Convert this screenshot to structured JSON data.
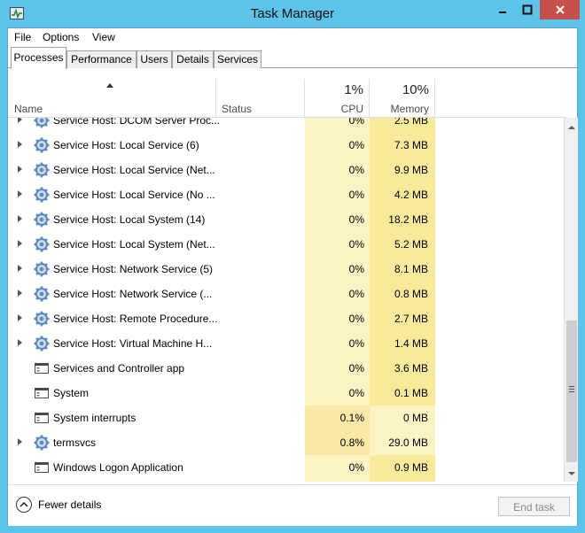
{
  "window": {
    "title": "Task Manager"
  },
  "menu": {
    "items": [
      "File",
      "Options",
      "View"
    ]
  },
  "tabs": [
    "Processes",
    "Performance",
    "Users",
    "Details",
    "Services"
  ],
  "active_tab": "Processes",
  "columns": {
    "name": "Name",
    "status": "Status",
    "cpu": {
      "label": "CPU",
      "total": "1%"
    },
    "memory": {
      "label": "Memory",
      "total": "10%"
    }
  },
  "rows": [
    {
      "name": "Service Host: DCOM Server Proc...",
      "cpu": "0%",
      "mem": "2.5 MB",
      "icon": "gear-icon",
      "expandable": true
    },
    {
      "name": "Service Host: Local Service (6)",
      "cpu": "0%",
      "mem": "7.3 MB",
      "icon": "gear-icon",
      "expandable": true
    },
    {
      "name": "Service Host: Local Service (Net...",
      "cpu": "0%",
      "mem": "9.9 MB",
      "icon": "gear-icon",
      "expandable": true
    },
    {
      "name": "Service Host: Local Service (No ...",
      "cpu": "0%",
      "mem": "4.2 MB",
      "icon": "gear-icon",
      "expandable": true
    },
    {
      "name": "Service Host: Local System (14)",
      "cpu": "0%",
      "mem": "18.2 MB",
      "icon": "gear-icon",
      "expandable": true
    },
    {
      "name": "Service Host: Local System (Net...",
      "cpu": "0%",
      "mem": "5.2 MB",
      "icon": "gear-icon",
      "expandable": true
    },
    {
      "name": "Service Host: Network Service (5)",
      "cpu": "0%",
      "mem": "8.1 MB",
      "icon": "gear-icon",
      "expandable": true
    },
    {
      "name": "Service Host: Network Service (...",
      "cpu": "0%",
      "mem": "0.8 MB",
      "icon": "gear-icon",
      "expandable": true
    },
    {
      "name": "Service Host: Remote Procedure...",
      "cpu": "0%",
      "mem": "2.7 MB",
      "icon": "gear-icon",
      "expandable": true
    },
    {
      "name": "Service Host: Virtual Machine H...",
      "cpu": "0%",
      "mem": "1.4 MB",
      "icon": "gear-icon",
      "expandable": true
    },
    {
      "name": "Services and Controller app",
      "cpu": "0%",
      "mem": "3.6 MB",
      "icon": "window-icon",
      "expandable": false
    },
    {
      "name": "System",
      "cpu": "0%",
      "mem": "0.1 MB",
      "icon": "window-icon",
      "expandable": false
    },
    {
      "name": "System interrupts",
      "cpu": "0.1%",
      "mem": "0 MB",
      "icon": "window-icon",
      "expandable": false,
      "highlight": true
    },
    {
      "name": "termsvcs",
      "cpu": "0.8%",
      "mem": "29.0 MB",
      "icon": "gear-icon",
      "expandable": true,
      "highlight": true
    },
    {
      "name": "Windows Logon Application",
      "cpu": "0%",
      "mem": "0.9 MB",
      "icon": "window-icon",
      "expandable": false
    }
  ],
  "footer": {
    "fewer_details": "Fewer details",
    "end_task": "End task"
  },
  "colors": {
    "title_bar": "#5ec3e8",
    "close_button": "#c7504c",
    "cpu_column": "#fcf3c5",
    "memory_column": "#f9ea9b"
  }
}
